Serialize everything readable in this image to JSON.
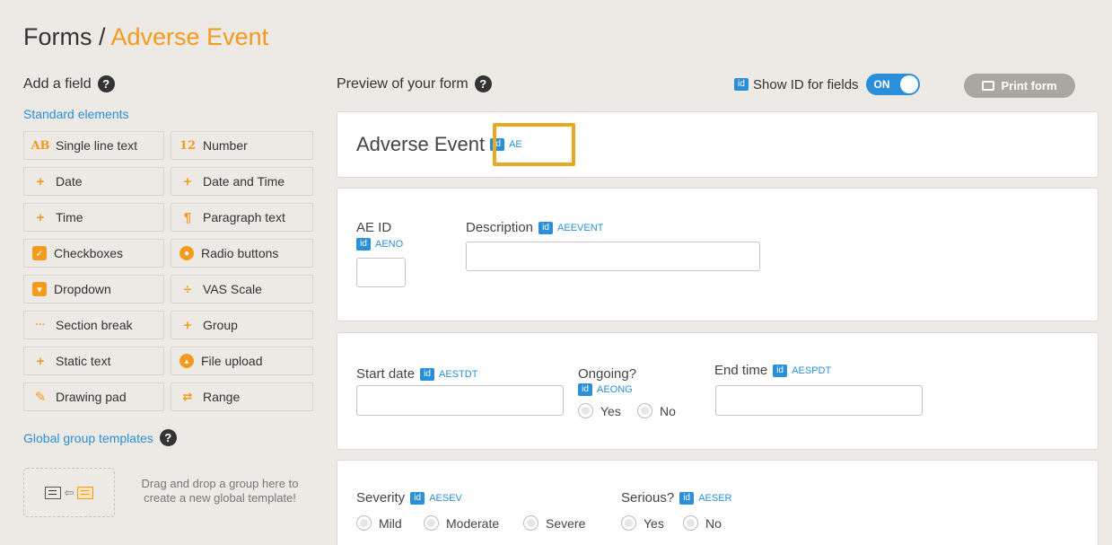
{
  "breadcrumb": {
    "root": "Forms / ",
    "current": "Adverse Event"
  },
  "left": {
    "heading": "Add a field",
    "standard_link": "Standard elements",
    "items": [
      {
        "icon": "AB",
        "label": "Single line text"
      },
      {
        "icon": "12",
        "label": "Number"
      },
      {
        "icon": "+",
        "label": "Date"
      },
      {
        "icon": "+",
        "label": "Date and Time"
      },
      {
        "icon": "+",
        "label": "Time"
      },
      {
        "icon": "¶",
        "label": "Paragraph text"
      },
      {
        "icon": "✓",
        "label": "Checkboxes"
      },
      {
        "icon": "●",
        "label": "Radio buttons"
      },
      {
        "icon": "▾",
        "label": "Dropdown"
      },
      {
        "icon": "÷",
        "label": "VAS Scale"
      },
      {
        "icon": "···",
        "label": "Section break"
      },
      {
        "icon": "+",
        "label": "Group"
      },
      {
        "icon": "+",
        "label": "Static text"
      },
      {
        "icon": "▲",
        "label": "File upload"
      },
      {
        "icon": "✎",
        "label": "Drawing pad"
      },
      {
        "icon": "⇄",
        "label": "Range"
      }
    ],
    "global_link": "Global group templates",
    "drop_text": "Drag and drop a group here to create a new global template!"
  },
  "preview": {
    "heading": "Preview of your form",
    "show_id_label": "Show ID for fields",
    "id_tag": "id",
    "toggle_state": "ON",
    "print_label": "Print form"
  },
  "form": {
    "title": "Adverse Event",
    "title_id": "AE",
    "fields": {
      "ae_id": {
        "label": "AE ID",
        "id": "AENO"
      },
      "description": {
        "label": "Description",
        "id": "AEEVENT"
      },
      "start_date": {
        "label": "Start date",
        "id": "AESTDT"
      },
      "ongoing": {
        "label": "Ongoing?",
        "id": "AEONG",
        "options": [
          "Yes",
          "No"
        ]
      },
      "end_time": {
        "label": "End time",
        "id": "AESPDT"
      },
      "severity": {
        "label": "Severity",
        "id": "AESEV",
        "options": [
          "Mild",
          "Moderate",
          "Severe"
        ]
      },
      "serious": {
        "label": "Serious?",
        "id": "AESER",
        "options": [
          "Yes",
          "No"
        ]
      }
    }
  },
  "colors": {
    "accent": "#f39a1f",
    "link": "#2a8fd8",
    "highlight": "#e8a920",
    "background": "#ede9e4"
  }
}
